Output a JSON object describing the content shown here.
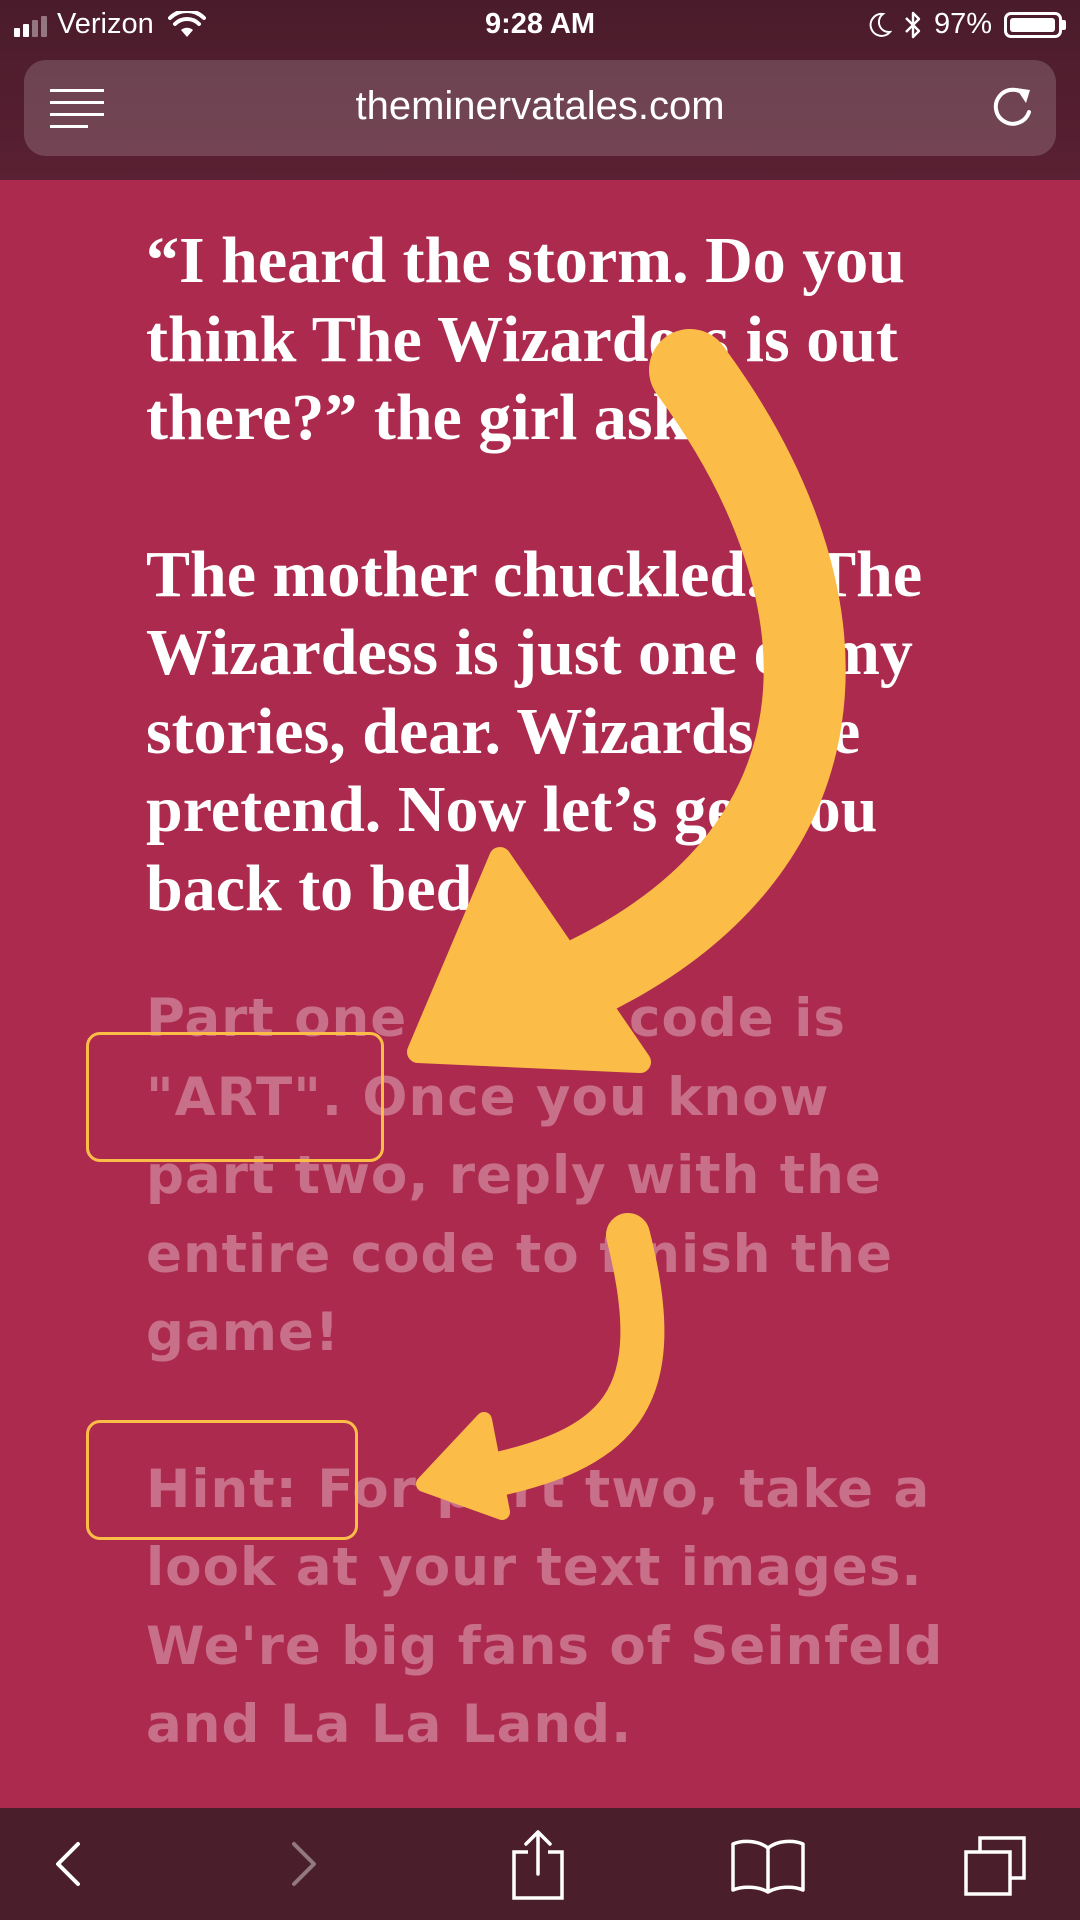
{
  "status_bar": {
    "carrier": "Verizon",
    "time": "9:28 AM",
    "battery": "97%",
    "battery_level": 0.97
  },
  "browser": {
    "url": "theminervatales.com"
  },
  "story": {
    "paragraph1": "“I heard the storm. Do you think The Wizardess is out there?” the girl asked.",
    "paragraph2": "The mother chuckled. “The Wizardess is just one of my stories, dear. Wizards are pretend. Now let’s get you back to bed.”"
  },
  "info": {
    "part_one": "Part one of the code is \"ART\". Once you know part two, reply with the entire code to finish the game!",
    "hint": "Hint: For part two, take a look at your text images. We're big fans of Seinfeld and La La Land."
  },
  "colors": {
    "page_background": "#ad2a4f",
    "highlight": "#fbbd47",
    "toolbar": "#4a1e2b"
  },
  "icons": {
    "menu": "menu-icon",
    "reload": "reload-icon",
    "back": "back-icon",
    "forward": "forward-icon",
    "share": "share-icon",
    "bookmarks": "bookmarks-icon",
    "tabs": "tabs-icon"
  }
}
